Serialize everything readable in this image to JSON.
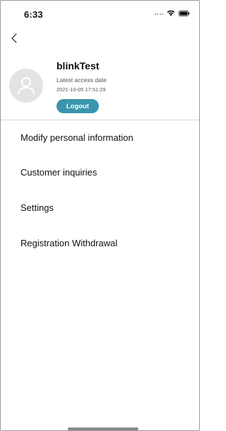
{
  "status_bar": {
    "time": "6:33"
  },
  "icons": {
    "back": "chevron-left-icon",
    "avatar": "person-outline-icon",
    "wifi": "wifi-icon",
    "battery": "battery-icon",
    "signal": "signal-dots-icon"
  },
  "profile": {
    "username": "blinkTest",
    "access_label": "Latest access date",
    "access_date": "2021-10-05 17:51:29",
    "logout_label": "Logout"
  },
  "menu": {
    "items": [
      {
        "label": "Modify personal information"
      },
      {
        "label": "Customer inquiries"
      },
      {
        "label": "Settings"
      },
      {
        "label": "Registration Withdrawal"
      }
    ]
  },
  "colors": {
    "accent": "#3a95ad",
    "avatar_bg": "#e3e3e3",
    "divider": "#d6d6d6"
  }
}
